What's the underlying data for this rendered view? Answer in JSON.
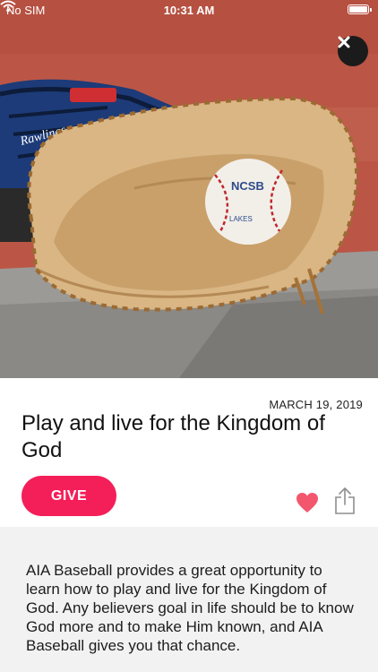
{
  "status_bar": {
    "carrier": "No SIM",
    "time": "10:31 AM",
    "wifi_icon": "wifi-icon",
    "battery_icon": "battery-icon"
  },
  "hero": {
    "image": "baseball-glove-photo",
    "close_icon": "close-icon",
    "mitt_brand": "Rawlings",
    "ball_text_1": "NCSB",
    "ball_text_2": "LAKES"
  },
  "post": {
    "date": "MARCH 19, 2019",
    "title": "Play and live for the Kingdom of God",
    "give_label": "GIVE",
    "like_icon": "heart-icon",
    "share_icon": "share-icon",
    "body": "AIA Baseball provides a great opportunity to learn how to play and live for the Kingdom of God.  Any believers goal in life should be to know God more and to make Him known, and AIA Baseball gives you that chance."
  },
  "colors": {
    "accent": "#f41e59",
    "heart": "#f2576e",
    "close_button_bg": "#1b1b1b",
    "body_bg": "#f2f2f2"
  }
}
